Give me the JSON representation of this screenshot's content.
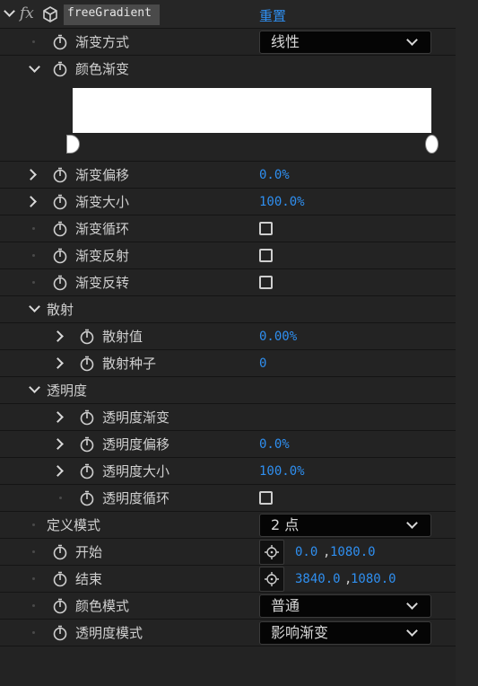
{
  "header": {
    "fx_label": "fx",
    "effect_name": "freeGradient",
    "reset_label": "重置"
  },
  "rows": {
    "gradient_mode": {
      "label": "渐变方式",
      "value": "线性"
    },
    "color_gradient": {
      "label": "颜色渐变"
    },
    "gradient_offset": {
      "label": "渐变偏移",
      "value": "0.0%"
    },
    "gradient_size": {
      "label": "渐变大小",
      "value": "100.0%"
    },
    "gradient_loop": {
      "label": "渐变循环",
      "checked": false
    },
    "gradient_reflect": {
      "label": "渐变反射",
      "checked": false
    },
    "gradient_reverse": {
      "label": "渐变反转",
      "checked": false
    },
    "scatter_group": {
      "label": "散射"
    },
    "scatter_value": {
      "label": "散射值",
      "value": "0.00%"
    },
    "scatter_seed": {
      "label": "散射种子",
      "value": "0"
    },
    "opacity_group": {
      "label": "透明度"
    },
    "opacity_gradient": {
      "label": "透明度渐变"
    },
    "opacity_offset": {
      "label": "透明度偏移",
      "value": "0.0%"
    },
    "opacity_size": {
      "label": "透明度大小",
      "value": "100.0%"
    },
    "opacity_loop": {
      "label": "透明度循环",
      "checked": false
    },
    "define_mode": {
      "label": "定义模式",
      "value": "2 点"
    },
    "start": {
      "label": "开始",
      "x": "0.0",
      "y": "1080.0"
    },
    "end": {
      "label": "结束",
      "x": "3840.0",
      "y": "1080.0"
    },
    "color_mode": {
      "label": "颜色模式",
      "value": "普通"
    },
    "opacity_mode": {
      "label": "透明度模式",
      "value": "影响渐变"
    }
  },
  "gradient_editor": {
    "ramp_color": "#ffffff"
  },
  "colors": {
    "accent": "#2f8ff0",
    "background": "#232323"
  }
}
